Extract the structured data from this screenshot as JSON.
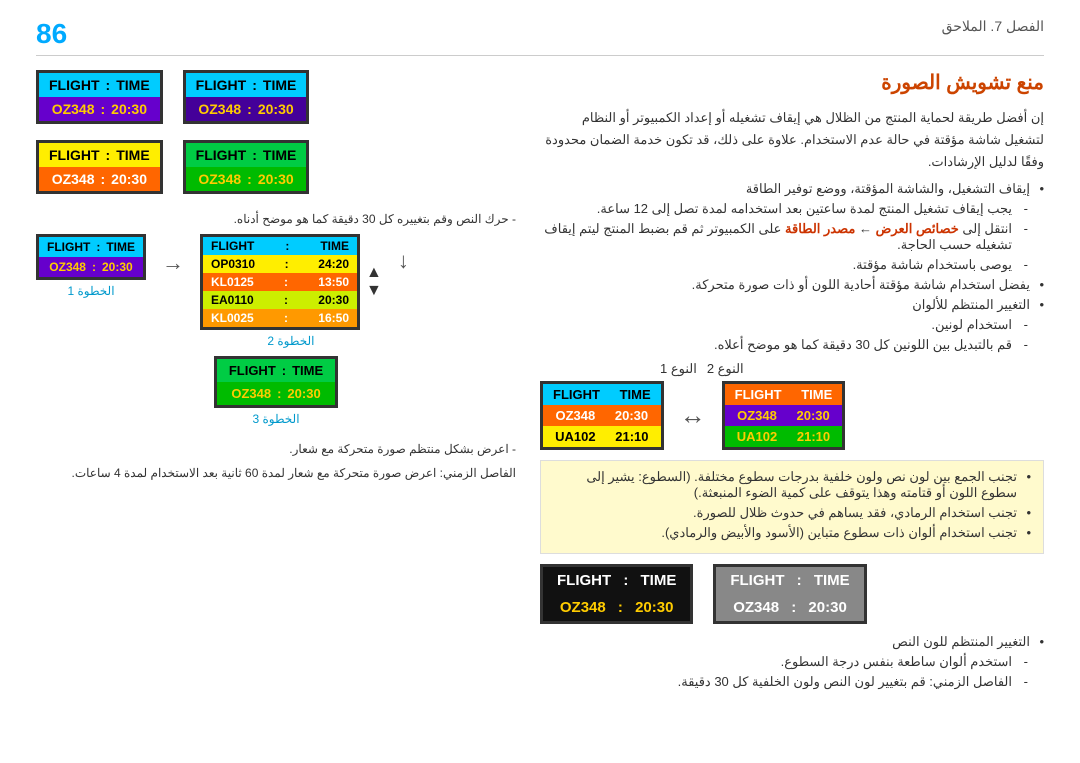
{
  "page": {
    "number": "86",
    "chapter": "الفصل 7. الملاحق"
  },
  "section_title": "منع تشويش الصورة",
  "intro_text": "إن أفضل طريقة لحماية المنتج من الظلال هي إيقاف تشغيله أو إعداد الكمبيوتر أو النظام لتشغيل شاشة مؤقتة في حالة عدم الاستخدام. علاوة على ذلك، قد تكون خدمة الضمان محدودة وفقًا لدليل الإرشادات.",
  "bullets": {
    "b1": "إيقاف التشغيل، والشاشة المؤقتة، ووضع توفير الطاقة",
    "b1_sub1": "يجب إيقاف تشغيل المنتج لمدة ساعتين بعد استخدامه لمدة تصل إلى 12 ساعة.",
    "b1_sub2": "انتقل إلى خصائص العرض ← مصدر الطاقة على الكمبيوتر ثم قم بضبط المنتج ليتم إيقاف تشغيله حسب الحاجة.",
    "b1_sub3": "يوصى باستخدام شاشة مؤقتة.",
    "b2": "يفضل استخدام شاشة مؤقتة أحادية اللون أو ذات صورة متحركة.",
    "b3": "التغيير المنتظم للألوان",
    "b3_sub1": "استخدام لونين.",
    "b3_sub2": "قم بالتبديل بين اللونين كل 30 دقيقة كما هو موضح أعلاه.",
    "type1_label": "النوع 1",
    "type2_label": "النوع 2",
    "highlight_b1": "تجنب الجمع بين لون نص ولون خلفية بدرجات سطوع مختلفة. (السطوع: يشير إلى سطوع اللون أو قتامته وهذا يتوقف على كمية الضوء المنبعثة.)",
    "highlight_b2": "تجنب استخدام الرمادي، فقد يساهم في حدوث ظلال للصورة.",
    "highlight_b3": "تجنب استخدام ألوان ذات سطوع متباين (الأسود والأبيض والرمادي).",
    "b4": "التغيير المنتظم للون النص",
    "b4_sub1": "استخدم ألوان ساطعة بنفس درجة السطوع.",
    "b4_sub2": "الفاصل الزمني: قم بتغيير لون النص ولون الخلفية كل 30 دقيقة."
  },
  "left_widgets": {
    "step_caption": "- حرك النص وقم بتغييره كل 30 دقيقة كما هو موضح أدناه.",
    "step1_label": "الخطوة 1",
    "step2_label": "الخطوة 2",
    "step3_label": "الخطوة 3",
    "note1": "- اعرض بشكل منتظم صورة متحركة مع شعار.",
    "note2": "الفاصل الزمني: اعرض صورة متحركة مع شعار لمدة 60 ثانية بعد الاستخدام لمدة 4 ساعات.",
    "w1_row1_left": "FLIGHT",
    "w1_row1_sep": ":",
    "w1_row1_right": "TIME",
    "w1_row2_left": "OZ348",
    "w1_row2_sep": ":",
    "w1_row2_right": "20:30",
    "w2_row1_left": "FLIGHT",
    "w2_row1_sep": ":",
    "w2_row1_right": "TIME",
    "w2_row2_left": "OZ348",
    "w2_row2_sep": ":",
    "w2_row2_right": "20:30",
    "w3_row1_left": "FLIGHT",
    "w3_row1_sep": ":",
    "w3_row1_right": "TIME",
    "w3_row2_left": "OZ348",
    "w3_row2_sep": ":",
    "w3_row2_right": "20:30",
    "w4_row1_left": "FLIGHT",
    "w4_row1_sep": ":",
    "w4_row1_right": "TIME",
    "w4_row2_left": "OZ348",
    "w4_row2_sep": ":",
    "w4_row2_right": "20:30",
    "multi_header_left": "FLIGHT",
    "multi_header_right": "TIME",
    "multi_d1l": "OP0310",
    "multi_d1r": "24:20",
    "multi_d2l": "KL0125",
    "multi_d2r": "13:50",
    "multi_d3l": "EA0110",
    "multi_d3r": "20:30",
    "multi_d4l": "KL0025",
    "multi_d4r": "16:50",
    "step3_row1_left": "FLIGHT",
    "step3_row1_sep": ":",
    "step3_row1_right": "TIME",
    "step3_row2_left": "OZ348",
    "step3_row2_sep": ":",
    "step3_row2_right": "20:30"
  },
  "right_widgets": {
    "t1_r1l": "FLIGHT",
    "t1_r1r": "TIME",
    "t1_r2l": "OZ348",
    "t1_r2r": "20:30",
    "t1_r3l": "UA102",
    "t1_r3r": "21:10",
    "t2_r1l": "FLIGHT",
    "t2_r1r": "TIME",
    "t2_r2l": "OZ348",
    "t2_r2r": "20:30",
    "t2_r3l": "UA102",
    "t2_r3r": "21:10",
    "b1_r1l": "FLIGHT",
    "b1_r1r": "TIME",
    "b1_r2l": "OZ348",
    "b1_r2r": "20:30",
    "b2_r1l": "FLIGHT",
    "b2_r1r": "TIME",
    "b2_r2l": "OZ348",
    "b2_r2r": "20:30"
  }
}
